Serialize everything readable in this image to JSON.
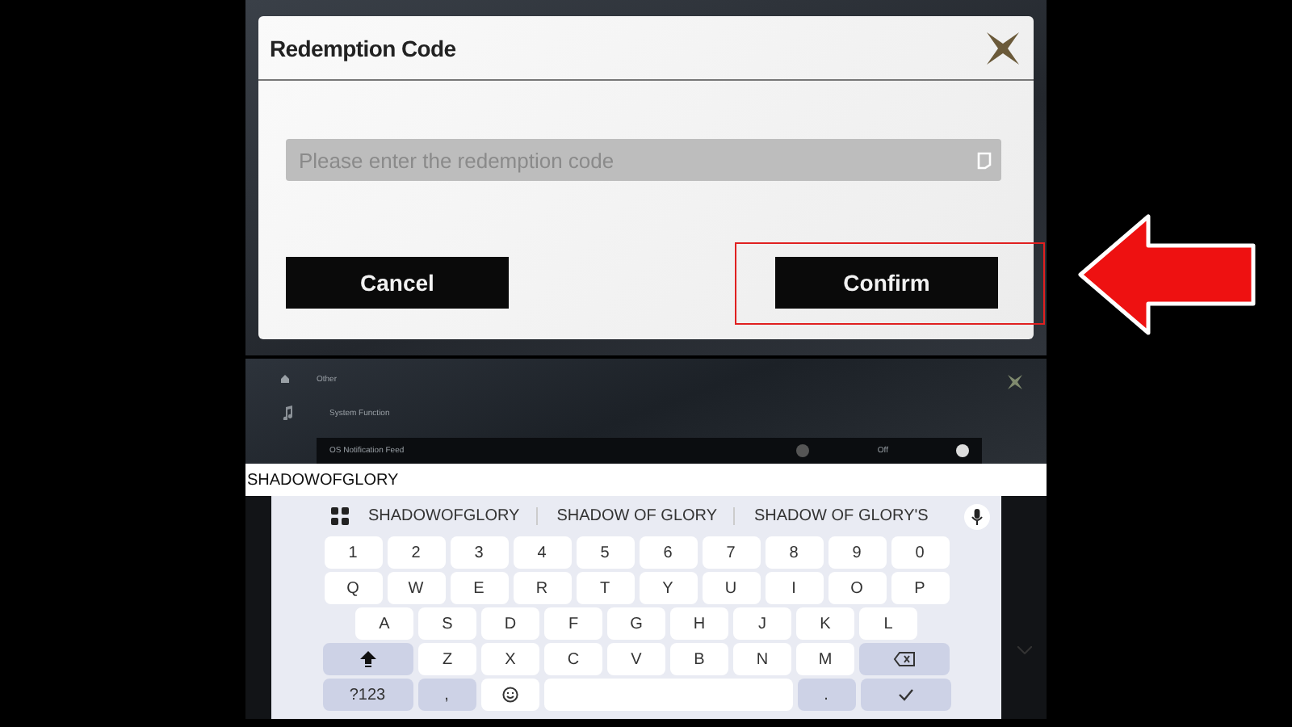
{
  "dialog": {
    "title": "Redemption Code",
    "placeholder": "Please enter the redemption code",
    "buttons": [
      {
        "label": "Cancel"
      },
      {
        "label": "Confirm"
      }
    ]
  },
  "settings": {
    "section": "Other",
    "group": "System Function",
    "row": {
      "label": "OS Notification Feed",
      "value": "Off"
    }
  },
  "text_field": {
    "value": "SHADOWOFGLORY"
  },
  "keyboard": {
    "suggestions": [
      "SHADOWOFGLORY",
      "SHADOW OF GLORY",
      "SHADOW OF GLORY'S"
    ],
    "rows": [
      [
        {
          "kind": "char",
          "label": "1"
        },
        {
          "kind": "char",
          "label": "2"
        },
        {
          "kind": "char",
          "label": "3"
        },
        {
          "kind": "char",
          "label": "4"
        },
        {
          "kind": "char",
          "label": "5"
        },
        {
          "kind": "char",
          "label": "6"
        },
        {
          "kind": "char",
          "label": "7"
        },
        {
          "kind": "char",
          "label": "8"
        },
        {
          "kind": "char",
          "label": "9"
        },
        {
          "kind": "char",
          "label": "0"
        }
      ],
      [
        {
          "kind": "char",
          "label": "Q"
        },
        {
          "kind": "char",
          "label": "W"
        },
        {
          "kind": "char",
          "label": "E"
        },
        {
          "kind": "char",
          "label": "R"
        },
        {
          "kind": "char",
          "label": "T"
        },
        {
          "kind": "char",
          "label": "Y"
        },
        {
          "kind": "char",
          "label": "U"
        },
        {
          "kind": "char",
          "label": "I"
        },
        {
          "kind": "char",
          "label": "O"
        },
        {
          "kind": "char",
          "label": "P"
        }
      ],
      [
        {
          "kind": "char",
          "label": "A"
        },
        {
          "kind": "char",
          "label": "S"
        },
        {
          "kind": "char",
          "label": "D"
        },
        {
          "kind": "char",
          "label": "F"
        },
        {
          "kind": "char",
          "label": "G"
        },
        {
          "kind": "char",
          "label": "H"
        },
        {
          "kind": "char",
          "label": "J"
        },
        {
          "kind": "char",
          "label": "K"
        },
        {
          "kind": "char",
          "label": "L"
        }
      ],
      [
        {
          "kind": "shift"
        },
        {
          "kind": "char",
          "label": "Z"
        },
        {
          "kind": "char",
          "label": "X"
        },
        {
          "kind": "char",
          "label": "C"
        },
        {
          "kind": "char",
          "label": "V"
        },
        {
          "kind": "char",
          "label": "B"
        },
        {
          "kind": "char",
          "label": "N"
        },
        {
          "kind": "char",
          "label": "M"
        },
        {
          "kind": "backspace"
        }
      ],
      [
        {
          "kind": "symbols",
          "label": "?123"
        },
        {
          "kind": "punct",
          "label": ","
        },
        {
          "kind": "emoji"
        },
        {
          "kind": "space"
        },
        {
          "kind": "punct",
          "label": "."
        },
        {
          "kind": "enter"
        }
      ]
    ]
  }
}
